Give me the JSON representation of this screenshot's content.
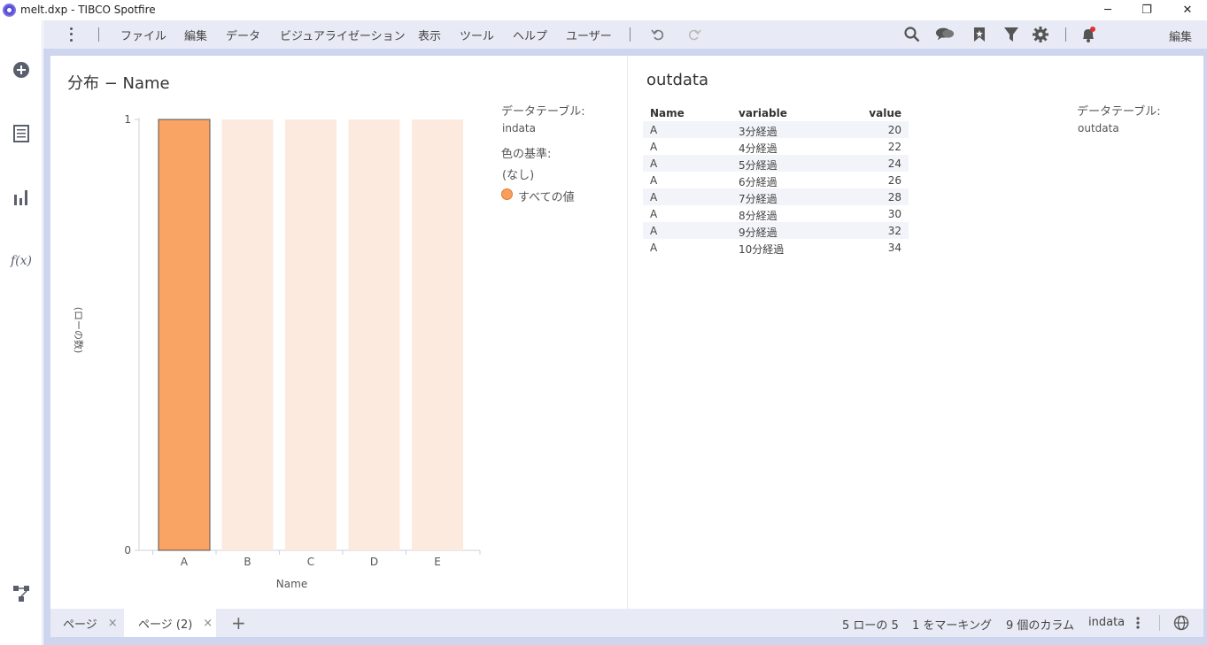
{
  "window": {
    "title": "melt.dxp - TIBCO Spotfire",
    "minimize": "─",
    "maximize": "❐",
    "close": "✕"
  },
  "menu": {
    "items": [
      "ファイル",
      "編集",
      "データ",
      "ビジュアライゼーション",
      "表示",
      "ツール",
      "ヘルプ",
      "ユーザー"
    ],
    "edit_mode": "編集"
  },
  "toolbar_icons": [
    "undo-icon",
    "redo-icon",
    "search-icon",
    "comments-icon",
    "bookmark-icon",
    "filter-icon",
    "settings-icon",
    "notifications-icon"
  ],
  "left_rail_icons": [
    "add-icon",
    "data-table-icon",
    "visualization-icon",
    "function-icon",
    "data-canvas-icon"
  ],
  "bar_chart": {
    "title": "分布 − Name",
    "legend": {
      "table_label": "データテーブル:",
      "table_value": "indata",
      "color_label": "色の基準:",
      "color_value": "(なし)",
      "item_label": "すべての値"
    }
  },
  "chart_data": {
    "type": "bar",
    "categories": [
      "A",
      "B",
      "C",
      "D",
      "E"
    ],
    "values": [
      1,
      1,
      1,
      1,
      1
    ],
    "marked": [
      true,
      false,
      false,
      false,
      false
    ],
    "xlabel": "Name",
    "ylabel": "(ローの数)",
    "ylim": [
      0,
      1
    ],
    "yticks": [
      "0",
      "1"
    ],
    "colors": {
      "marked": "#f9a464",
      "unmarked": "#fdeadf",
      "marked_border": "#555555"
    },
    "grid": false,
    "legend_position": "right"
  },
  "table": {
    "title": "outdata",
    "columns": [
      "Name",
      "variable",
      "value"
    ],
    "rows": [
      [
        "A",
        "3分経過",
        "20"
      ],
      [
        "A",
        "4分経過",
        "22"
      ],
      [
        "A",
        "5分経過",
        "24"
      ],
      [
        "A",
        "6分経過",
        "26"
      ],
      [
        "A",
        "7分経過",
        "28"
      ],
      [
        "A",
        "8分経過",
        "30"
      ],
      [
        "A",
        "9分経過",
        "32"
      ],
      [
        "A",
        "10分経過",
        "34"
      ]
    ],
    "legend": {
      "table_label": "データテーブル:",
      "table_value": "outdata"
    }
  },
  "pages": [
    {
      "label": "ページ",
      "close": "×",
      "active": false
    },
    {
      "label": "ページ (2)",
      "close": "×",
      "active": true
    }
  ],
  "add_page": "+",
  "status": {
    "rows": "5 ローの 5",
    "marked": "1 をマーキング",
    "columns": "9 個のカラム",
    "table": "indata"
  }
}
